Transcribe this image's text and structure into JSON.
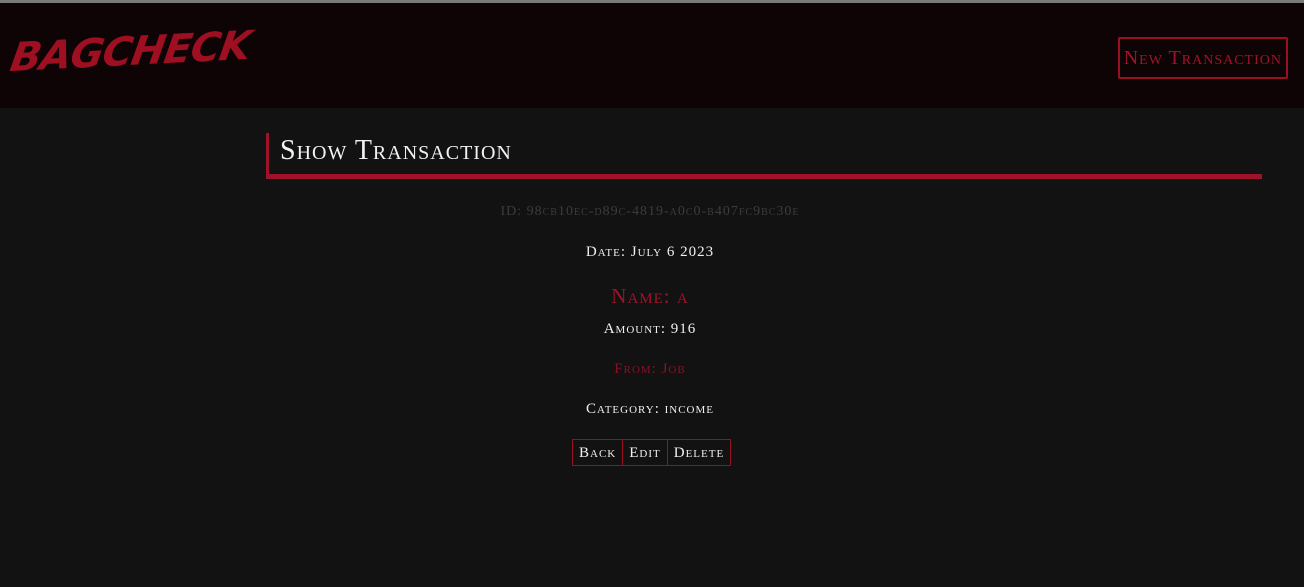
{
  "nav": {
    "logo_text": "BAGCHECK",
    "new_transaction_label": "New Transaction"
  },
  "page": {
    "title": "Show Transaction"
  },
  "transaction": {
    "id_text": "ID: 98cb10ec-d89c-4819-a0c0-b407fc9bc30e",
    "date_text": "Date: July 6 2023",
    "name_text": "Name: a",
    "amount_text": "Amount: 916",
    "from_text": "From: Job",
    "category_text": "Category: income"
  },
  "actions": {
    "back_label": "Back",
    "edit_label": "Edit",
    "delete_label": "Delete"
  },
  "colors": {
    "accent": "#a0122a",
    "background": "#121212",
    "navbar": "#0f0405",
    "text": "#f0f0f0",
    "muted": "#3c3c3c"
  }
}
